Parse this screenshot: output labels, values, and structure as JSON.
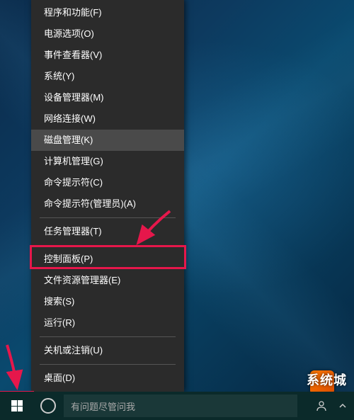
{
  "menu": {
    "items": [
      {
        "label": "程序和功能(F)",
        "name": "menu-programs-features"
      },
      {
        "label": "电源选项(O)",
        "name": "menu-power-options"
      },
      {
        "label": "事件查看器(V)",
        "name": "menu-event-viewer"
      },
      {
        "label": "系统(Y)",
        "name": "menu-system"
      },
      {
        "label": "设备管理器(M)",
        "name": "menu-device-manager"
      },
      {
        "label": "网络连接(W)",
        "name": "menu-network-connections"
      },
      {
        "label": "磁盘管理(K)",
        "name": "menu-disk-management",
        "hover": true
      },
      {
        "label": "计算机管理(G)",
        "name": "menu-computer-management"
      },
      {
        "label": "命令提示符(C)",
        "name": "menu-command-prompt"
      },
      {
        "label": "命令提示符(管理员)(A)",
        "name": "menu-command-prompt-admin"
      },
      {
        "sep": true
      },
      {
        "label": "任务管理器(T)",
        "name": "menu-task-manager"
      },
      {
        "sep": true
      },
      {
        "label": "控制面板(P)",
        "name": "menu-control-panel"
      },
      {
        "label": "文件资源管理器(E)",
        "name": "menu-file-explorer"
      },
      {
        "label": "搜索(S)",
        "name": "menu-search"
      },
      {
        "label": "运行(R)",
        "name": "menu-run"
      },
      {
        "sep": true
      },
      {
        "label": "关机或注销(U)",
        "name": "menu-shutdown-signout"
      },
      {
        "sep": true
      },
      {
        "label": "桌面(D)",
        "name": "menu-desktop"
      }
    ]
  },
  "taskbar": {
    "search_placeholder": "有问题尽管问我"
  },
  "watermark": "系统城",
  "colors": {
    "highlight": "#e6174b",
    "menu_bg": "#2b2b2b",
    "menu_hover": "#4a4a4a"
  }
}
